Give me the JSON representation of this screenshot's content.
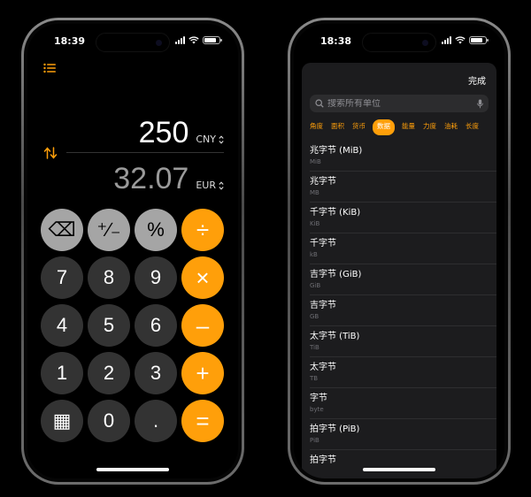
{
  "converter": {
    "status_time": "18:39",
    "from_amount": "250",
    "from_currency": "CNY",
    "to_amount": "32.07",
    "to_currency": "EUR",
    "keys": [
      {
        "label": "⌫",
        "kind": "fn",
        "name": "backspace-key"
      },
      {
        "label": "⁺∕₋",
        "kind": "fn",
        "name": "plus-minus-key"
      },
      {
        "label": "%",
        "kind": "fn",
        "name": "percent-key"
      },
      {
        "label": "÷",
        "kind": "op",
        "name": "divide-key"
      },
      {
        "label": "7",
        "kind": "num",
        "name": "digit-7-key"
      },
      {
        "label": "8",
        "kind": "num",
        "name": "digit-8-key"
      },
      {
        "label": "9",
        "kind": "num",
        "name": "digit-9-key"
      },
      {
        "label": "×",
        "kind": "op",
        "name": "multiply-key"
      },
      {
        "label": "4",
        "kind": "num",
        "name": "digit-4-key"
      },
      {
        "label": "5",
        "kind": "num",
        "name": "digit-5-key"
      },
      {
        "label": "6",
        "kind": "num",
        "name": "digit-6-key"
      },
      {
        "label": "–",
        "kind": "op",
        "name": "subtract-key"
      },
      {
        "label": "1",
        "kind": "num",
        "name": "digit-1-key"
      },
      {
        "label": "2",
        "kind": "num",
        "name": "digit-2-key"
      },
      {
        "label": "3",
        "kind": "num",
        "name": "digit-3-key"
      },
      {
        "label": "+",
        "kind": "op",
        "name": "add-key"
      },
      {
        "label": "▦",
        "kind": "num",
        "name": "calculator-icon-key"
      },
      {
        "label": "0",
        "kind": "num",
        "name": "digit-0-key"
      },
      {
        "label": ".",
        "kind": "num",
        "name": "decimal-key"
      },
      {
        "label": "=",
        "kind": "op",
        "name": "equals-key"
      }
    ],
    "accent_color": "#ff9f0a"
  },
  "units": {
    "status_time": "18:38",
    "done_label": "完成",
    "search_placeholder": "搜索所有单位",
    "categories": [
      "角度",
      "面积",
      "货币",
      "数据",
      "能量",
      "力度",
      "油耗",
      "长度"
    ],
    "active_category": "数据",
    "items": [
      {
        "name": "兆字节 (MiB)",
        "abbr": "MiB"
      },
      {
        "name": "兆字节",
        "abbr": "MB"
      },
      {
        "name": "千字节 (KiB)",
        "abbr": "KiB"
      },
      {
        "name": "千字节",
        "abbr": "kB"
      },
      {
        "name": "吉字节 (GiB)",
        "abbr": "GiB"
      },
      {
        "name": "吉字节",
        "abbr": "GB"
      },
      {
        "name": "太字节 (TiB)",
        "abbr": "TiB"
      },
      {
        "name": "太字节",
        "abbr": "TB"
      },
      {
        "name": "字节",
        "abbr": "byte"
      },
      {
        "name": "拍字节 (PiB)",
        "abbr": "PiB"
      },
      {
        "name": "拍字节",
        "abbr": ""
      }
    ]
  }
}
